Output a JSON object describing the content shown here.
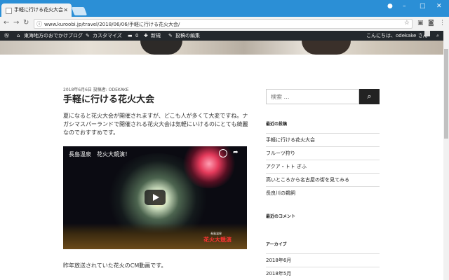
{
  "browser": {
    "tab_title": "手軽に行ける花火大会 – 東",
    "url": "www.kuroobi.jp/travel/2018/06/06/手軽に行ける花火大会/"
  },
  "adminbar": {
    "site_name": "東海地方のおでかけブログ",
    "customize": "カスタマイズ",
    "comments_count": "0",
    "new": "新規",
    "edit_post": "投稿の編集",
    "greeting": "こんにちは、odekake さん"
  },
  "post": {
    "meta": "2018年6月6日 投稿者: ODEKAKE",
    "title": "手軽に行ける花火大会",
    "body": "夏になると花火大会が開催されますが、どこも人が多くて大変ですね。ナガシマスパーランドで開催される花火大会は気軽にいけるのにとても綺麗なのでおすすめです。",
    "video_title": "長島温泉　花火大競演！",
    "video_caption_small": "長島温泉",
    "video_caption": "花火大競演",
    "footer": "昨年放送されていた花火のCM動画です。"
  },
  "sidebar": {
    "search_placeholder": "検索 …",
    "recent_posts_title": "最近の投稿",
    "recent_posts": [
      "手軽に行ける花火大会",
      "フルーツ狩り",
      "アクア・トト ぎふ",
      "高いところから名古屋の街を見てみる",
      "長良川の鵜飼"
    ],
    "recent_comments_title": "最近のコメント",
    "archives_title": "アーカイブ",
    "archives": [
      "2018年6月",
      "2018年5月"
    ]
  }
}
